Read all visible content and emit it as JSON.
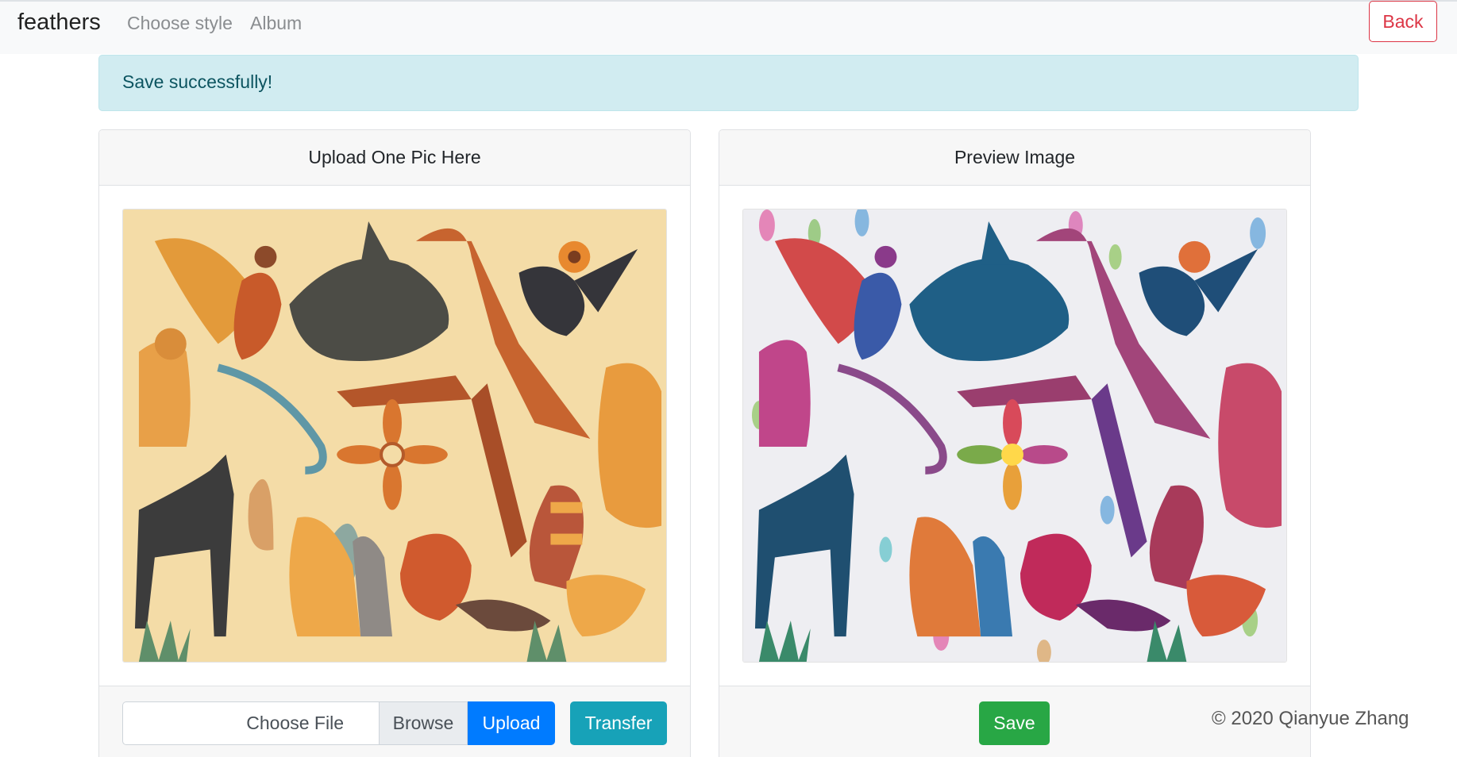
{
  "navbar": {
    "brand": "feathers",
    "links": [
      "Choose style",
      "Album"
    ],
    "back_label": "Back"
  },
  "alert": {
    "message": "Save successfully!"
  },
  "upload_card": {
    "header": "Upload One Pic Here",
    "file_input_label": "Choose File",
    "browse_label": "Browse",
    "upload_label": "Upload",
    "transfer_label": "Transfer"
  },
  "preview_card": {
    "header": "Preview Image",
    "save_label": "Save"
  },
  "footer": {
    "copyright": "© 2020 Qianyue Zhang"
  },
  "colors": {
    "original_background": "#f4dca7",
    "danger": "#dc3545",
    "info_alert_bg": "#d1ecf1",
    "primary": "#007bff",
    "info": "#17a2b8",
    "success": "#28a745"
  }
}
